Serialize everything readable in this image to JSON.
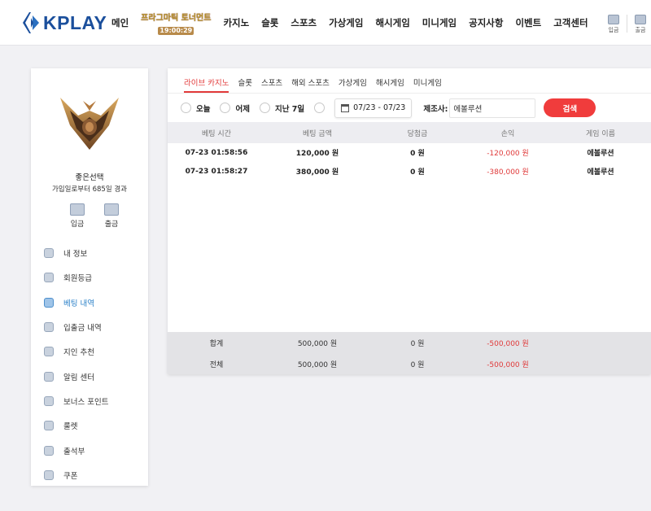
{
  "brand": {
    "name": "KPLAY"
  },
  "nav": {
    "items": [
      "메인",
      "카지노",
      "슬롯",
      "스포츠",
      "가상게임",
      "해시게임",
      "미니게임",
      "공지사항",
      "이벤트",
      "고객센터"
    ],
    "promo_title": "프라그마틱 토너먼트",
    "promo_badge": "19:00:29"
  },
  "header_actions": {
    "deposit": "입금",
    "withdraw": "출금"
  },
  "sidebar": {
    "username": "좋은선택",
    "joined": "가입일로부터 685일 경과",
    "actions": {
      "deposit": "입금",
      "withdraw": "출금"
    },
    "menu": [
      "내 정보",
      "회원등급",
      "베팅 내역",
      "입출금 내역",
      "지인 추천",
      "알림 센터",
      "보너스 포인트",
      "룰렛",
      "출석부",
      "쿠폰"
    ],
    "active_index": 2
  },
  "tabs": [
    "라이브 카지노",
    "슬롯",
    "스포츠",
    "해외 스포츠",
    "가상게임",
    "해시게임",
    "미니게임"
  ],
  "filters": {
    "today": "오늘",
    "yesterday": "어제",
    "last7": "지난 7일",
    "date_range": "07/23 - 07/23",
    "maker_label": "제조사:",
    "maker_value": "에볼루션",
    "search": "검색"
  },
  "table": {
    "headers": [
      "베팅 시간",
      "베팅 금액",
      "당첨금",
      "손익",
      "게임 이름"
    ],
    "rows": [
      [
        "07-23 01:58:56",
        "120,000 원",
        "0 원",
        "-120,000 원",
        "에볼루션"
      ],
      [
        "07-23 01:58:27",
        "380,000 원",
        "0 원",
        "-380,000 원",
        "에볼루션"
      ]
    ],
    "totals": [
      [
        "합계",
        "500,000 원",
        "0 원",
        "-500,000 원"
      ],
      [
        "전체",
        "500,000 원",
        "0 원",
        "-500,000 원"
      ]
    ]
  },
  "colors": {
    "brand": "#1b4f9c",
    "accent": "#e23a3a",
    "active_menu": "#2a80c8"
  }
}
